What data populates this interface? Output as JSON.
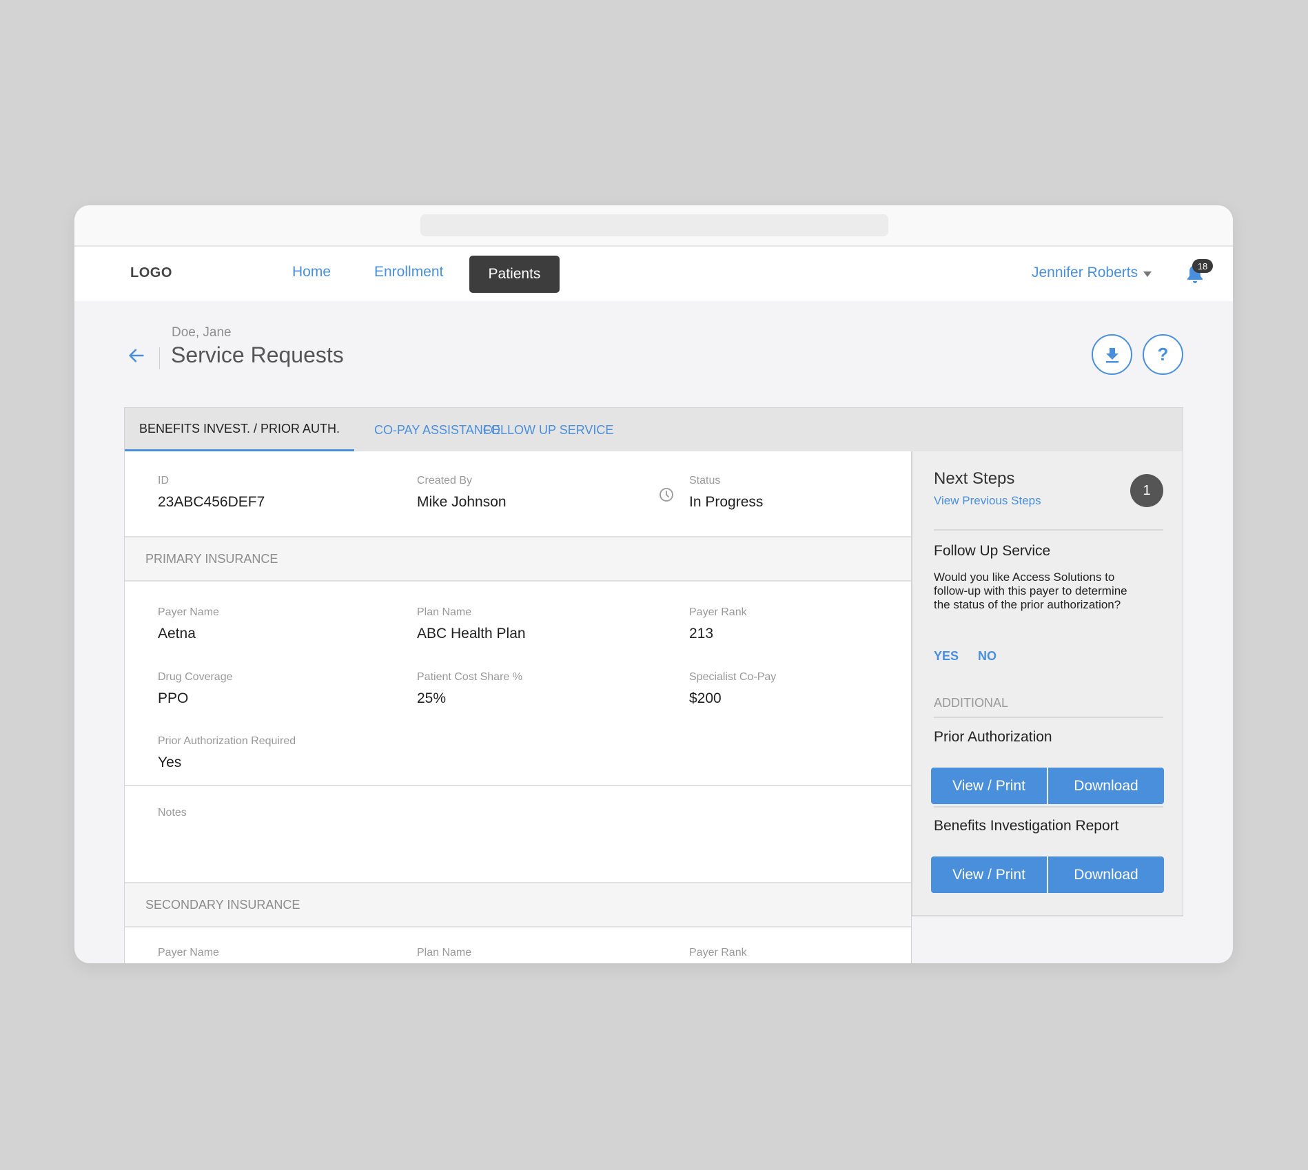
{
  "nav": {
    "logo": "LOGO",
    "links": [
      "Home",
      "Enrollment"
    ],
    "active": "Patients",
    "user": "Jennifer Roberts",
    "notification_count": "18"
  },
  "header": {
    "breadcrumb": "Doe, Jane",
    "title": "Service Requests",
    "help_label": "?"
  },
  "tabs": [
    "BENEFITS INVEST. / PRIOR AUTH.",
    "CO-PAY ASSISTANCE",
    "FOLLOW UP SERVICE"
  ],
  "meta": {
    "id_label": "ID",
    "id_value": "23ABC456DEF7",
    "created_label": "Created By",
    "created_value": "Mike Johnson",
    "status_label": "Status",
    "status_value": "In Progress"
  },
  "primary": {
    "heading": "PRIMARY INSURANCE",
    "fields": [
      {
        "label": "Payer Name",
        "value": "Aetna"
      },
      {
        "label": "Plan Name",
        "value": "ABC Health Plan"
      },
      {
        "label": "Payer Rank",
        "value": "213"
      },
      {
        "label": "Drug Coverage",
        "value": "PPO"
      },
      {
        "label": "Patient Cost Share %",
        "value": "25%"
      },
      {
        "label": "Specialist Co-Pay",
        "value": "$200"
      },
      {
        "label": "Prior Authorization Required",
        "value": "Yes"
      }
    ],
    "notes_label": "Notes"
  },
  "secondary": {
    "heading": "SECONDARY INSURANCE",
    "fields": [
      {
        "label": "Payer Name"
      },
      {
        "label": "Plan Name"
      },
      {
        "label": "Payer Rank"
      }
    ]
  },
  "side": {
    "title": "Next Steps",
    "link": "View Previous Steps",
    "count": "1",
    "follow_title": "Follow Up Service",
    "follow_text": "Would you like Access Solutions to follow-up with this payer to determine the status of the prior authorization?",
    "yes": "YES",
    "no": "NO",
    "additional": "ADDITIONAL",
    "docs": [
      {
        "title": "Prior Authorization",
        "view": "View / Print",
        "download": "Download"
      },
      {
        "title": "Benefits Investigation Report",
        "view": "View / Print",
        "download": "Download"
      }
    ]
  },
  "colors": {
    "accent": "#4a8fdb",
    "dark": "#3d3d3d"
  }
}
